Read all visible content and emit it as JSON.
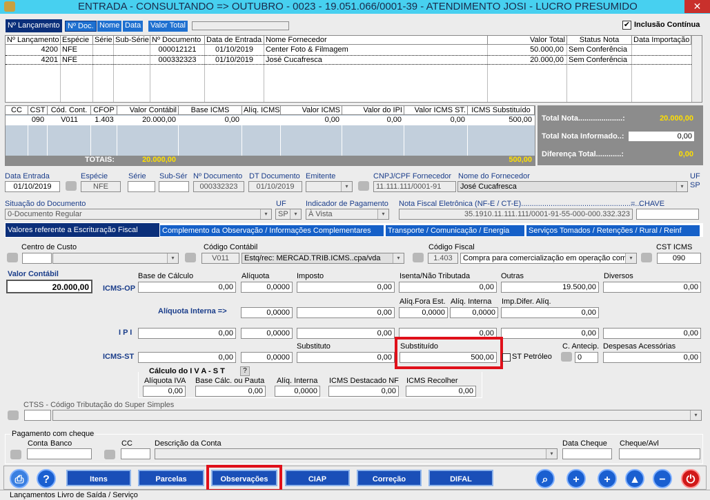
{
  "window": {
    "title": "ENTRADA  -  CONSULTANDO   =>   OUTUBRO   -  0023 - 19.051.066/0001-39 - ATENDIMENTO JOSI - LUCRO PRESUMIDO",
    "close": "✕"
  },
  "search_tabs": [
    "Nº Lançamento",
    "Nº Doc.",
    "Nome",
    "Data",
    "Valor Total"
  ],
  "inclusao_continua": "Inclusão Contínua",
  "docs_table": {
    "headers": [
      "Nº Lançamento",
      "Espécie",
      "Série",
      "Sub-Série",
      "Nº Documento",
      "Data de Entrada",
      "Nome Fornecedor",
      "Valor Total",
      "Status Nota",
      "Data Importação"
    ],
    "rows": [
      [
        "4200",
        "NFE",
        "",
        "",
        "000012121",
        "01/10/2019",
        "Center Foto & Filmagem",
        "50.000,00",
        "Sem Conferência",
        ""
      ],
      [
        "4201",
        "NFE",
        "",
        "",
        "000332323",
        "01/10/2019",
        "José Cucafresca",
        "20.000,00",
        "Sem Conferência",
        ""
      ]
    ]
  },
  "items_table": {
    "headers": [
      "CC",
      "CST",
      "Cód. Cont.",
      "CFOP",
      "Valor Contábil",
      "Base ICMS",
      "Alíq. ICMS",
      "Valor ICMS",
      "Valor do IPI",
      "Valor ICMS ST.",
      "ICMS Substituído"
    ],
    "rows": [
      [
        "",
        "090",
        "V011",
        "1.403",
        "20.000,00",
        "0,00",
        "",
        "0,00",
        "0,00",
        "0,00",
        "500,00"
      ]
    ],
    "totais_label": "TOTAIS:",
    "totais_valor": "20.000,00",
    "totais_subst": "500,00"
  },
  "summary": {
    "total_nota_label": "Total Nota.....................:",
    "total_nota": "20.000,00",
    "total_informado_label": "Total Nota Informado..:",
    "total_informado": "0,00",
    "diferenca_label": "Diferença Total............:",
    "diferenca": "0,00"
  },
  "header_fields": {
    "data_entrada_label": "Data Entrada",
    "data_entrada": "01/10/2019",
    "especie_label": "Espécie",
    "especie": "NFE",
    "serie_label": "Série",
    "serie": "",
    "subserie_label": "Sub-Sér",
    "subserie": "",
    "ndoc_label": "Nº Documento",
    "ndoc": "000332323",
    "dtdoc_label": "DT Documento",
    "dtdoc": "01/10/2019",
    "emitente_label": "Emitente",
    "emitente": "",
    "cnpj_label": "CNPJ/CPF Fornecedor",
    "cnpj": "11.111.111/0001-91",
    "nome_label": "Nome do Fornecedor",
    "nome": "José Cucafresca",
    "uf_label": "UF",
    "uf": "SP",
    "situacao_label": "Situação do Documento",
    "situacao": "0-Documento Regular",
    "uf2_label": "UF",
    "uf2": "SP",
    "indicador_label": "Indicador de Pagamento",
    "indicador": "À Vista",
    "nfe_label": "Nota Fiscal Eletrônica (NF-E / CT-E)..........................................................",
    "nfe": "35.1910.11.111.111/0001-91-55-000-000.332.323",
    "eq": "=",
    "chave_label": "CHAVE",
    "chave": ""
  },
  "section_tabs": [
    "Valores referente a Escrituração Fiscal",
    "Complemento da Observação / Informações Complementares",
    "Transporte / Comunicação / Energia",
    "Serviços Tomados / Retenções / Rural / Reinf"
  ],
  "fiscal": {
    "centro_custo_label": "Centro de Custo",
    "cod_contabil_label": "Código Contábil",
    "cod_contabil": "V011",
    "cod_contabil_desc": "Estq/rec: MERCAD.TRIB.ICMS..cpa/vda",
    "cod_fiscal_label": "Código Fiscal",
    "cod_fiscal": "1.403",
    "cod_fiscal_desc": "Compra para comercialização em operação com",
    "cst_label": "CST ICMS",
    "cst": "090",
    "valor_contabil_label": "Valor Contábil",
    "valor_contabil": "20.000,00",
    "icms_op": "ICMS-OP",
    "base_calc_label": "Base de Cálculo",
    "base_calc": "0,00",
    "aliquota_label": "Alíquota",
    "aliquota": "0,0000",
    "imposto_label": "Imposto",
    "imposto": "0,00",
    "isenta_label": "Isenta/Não Tributada",
    "isenta": "0,00",
    "outras_label": "Outras",
    "outras": "19.500,00",
    "diversos_label": "Diversos",
    "diversos": "0,00",
    "aliq_interna_arrow": "Alíquota Interna =>",
    "ai_aliq": "0,0000",
    "ai_imp": "0,00",
    "aliq_fora_label": "Alíq.Fora Est.",
    "aliq_fora": "0,0000",
    "aliq_interna_label": "Alíq. Interna",
    "aliq_interna": "0,0000",
    "imp_difer_label": "Imp.Difer. Alíq.",
    "imp_difer": "0,00",
    "ipi": "I P I",
    "ipi_base": "0,00",
    "ipi_aliq": "0,0000",
    "ipi_imp": "0,00",
    "ipi_isenta": "0,00",
    "ipi_outras": "0,00",
    "ipi_div": "0,00",
    "icms_st": "ICMS-ST",
    "st_base": "0,00",
    "st_aliq": "0,0000",
    "substituto_label": "Substituto",
    "substituto": "0,00",
    "substituido_label": "Substituído",
    "substituido": "500,00",
    "st_petroleo": "ST Petróleo",
    "c_antecip_label": "C. Antecip.",
    "c_antecip": "0",
    "desp_acess_label": "Despesas Acessórias",
    "desp_acess": "0,00",
    "calc_iva_title": "Cálculo  do  I V A - S T",
    "help": "?",
    "aliq_iva_label": "Alíquota IVA",
    "aliq_iva": "0,00",
    "base_pauta_label": "Base Cálc. ou Pauta",
    "base_pauta": "0,00",
    "aliq_interna2_label": "Alíq. Interna",
    "aliq_interna2": "0,0000",
    "icms_destacado_label": "ICMS Destacado NF",
    "icms_destacado": "0,00",
    "icms_recolher_label": "ICMS Recolher",
    "icms_recolher": "0,00",
    "ctss_label": "CTSS - Código Tributação do Super Simples"
  },
  "cheque": {
    "title": "Pagamento com cheque",
    "conta_label": "Conta",
    "banco_label": "Banco",
    "cc_label": "CC",
    "desc_label": "Descrição da Conta",
    "data_label": "Data Cheque",
    "avl_label": "Cheque/Avl"
  },
  "bottom_buttons": [
    "Itens",
    "Parcelas",
    "Observações",
    "CIAP",
    "Correção",
    "DIFAL"
  ],
  "status_text": "Lançamentos Livro de Saída / Serviço"
}
